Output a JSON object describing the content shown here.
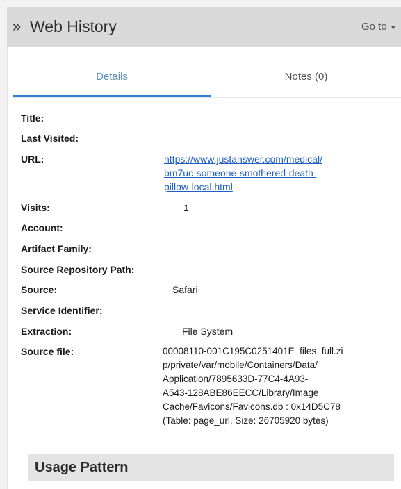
{
  "header": {
    "title": "Web History",
    "goto_label": "Go to"
  },
  "tabs": [
    {
      "label": "Details",
      "active": true
    },
    {
      "label": "Notes (0)",
      "active": false
    }
  ],
  "fields": {
    "title": {
      "label": "Title:",
      "value": ""
    },
    "last_visited": {
      "label": "Last Visited:",
      "value": ""
    },
    "url": {
      "label": "URL:",
      "lines": [
        "https://www.justanswer.com/medical/",
        "bm7uc-someone-smothered-death-",
        "pillow-local.html"
      ]
    },
    "visits": {
      "label": "Visits:",
      "value": "1"
    },
    "account": {
      "label": "Account:",
      "value": ""
    },
    "artifact_family": {
      "label": "Artifact Family:",
      "value": ""
    },
    "source_repository_path": {
      "label": "Source Repository Path:",
      "value": ""
    },
    "source": {
      "label": "Source:",
      "value": "Safari"
    },
    "service_identifier": {
      "label": "Service Identifier:",
      "value": ""
    },
    "extraction": {
      "label": "Extraction:",
      "value": "File System"
    },
    "source_file": {
      "label": "Source file:",
      "lines": [
        "00008110-001C195C0251401E_files_full.zi",
        "p/private/var/mobile/Containers/Data/",
        "Application/7895633D-77C4-4A93-",
        "A543-128ABE86EECC/Library/Image",
        "Cache/Favicons/Favicons.db : 0x14D5C78",
        "(Table: page_url, Size: 26705920 bytes)"
      ]
    }
  },
  "usage_pattern": {
    "title": "Usage Pattern"
  },
  "colors": {
    "accent": "#2b7fd4",
    "link": "#1f5fbf",
    "header_bg": "#d9d9d9"
  }
}
